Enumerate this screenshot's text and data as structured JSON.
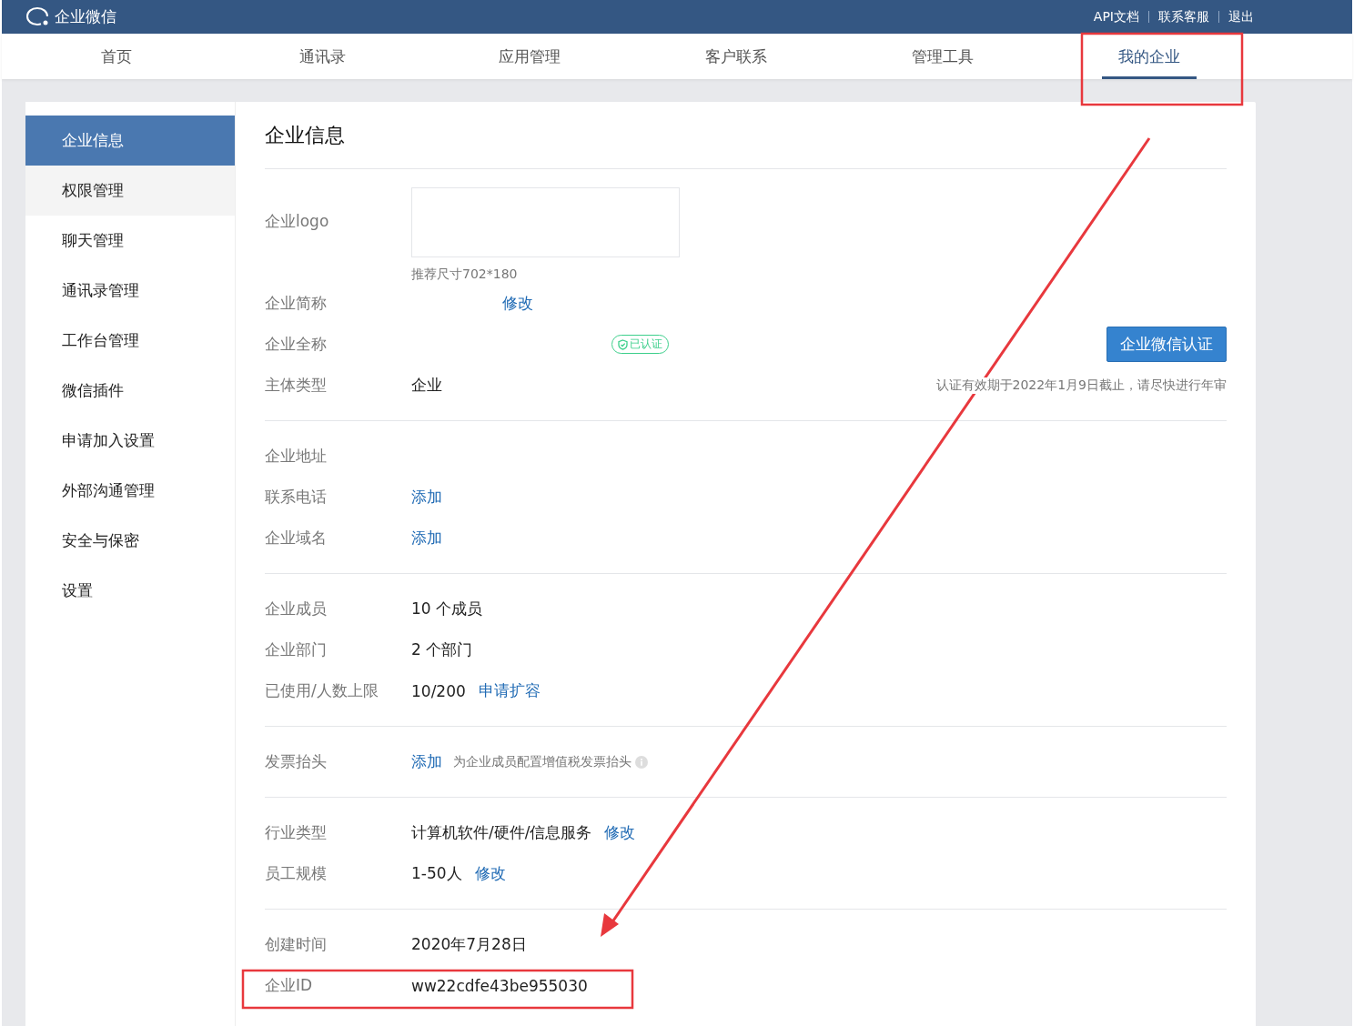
{
  "topbar": {
    "brand": "企业微信",
    "links": [
      "API文档",
      "联系客服",
      "退出"
    ]
  },
  "nav": [
    {
      "label": "首页",
      "selected": false
    },
    {
      "label": "通讯录",
      "selected": false
    },
    {
      "label": "应用管理",
      "selected": false
    },
    {
      "label": "客户联系",
      "selected": false
    },
    {
      "label": "管理工具",
      "selected": false
    },
    {
      "label": "我的企业",
      "selected": true
    }
  ],
  "sidebar": [
    {
      "label": "企业信息",
      "selected": true
    },
    {
      "label": "权限管理",
      "selected": false
    },
    {
      "label": "聊天管理",
      "selected": false
    },
    {
      "label": "通讯录管理",
      "selected": false
    },
    {
      "label": "工作台管理",
      "selected": false
    },
    {
      "label": "微信插件",
      "selected": false
    },
    {
      "label": "申请加入设置",
      "selected": false
    },
    {
      "label": "外部沟通管理",
      "selected": false
    },
    {
      "label": "安全与保密",
      "selected": false
    },
    {
      "label": "设置",
      "selected": false
    }
  ],
  "title": "企业信息",
  "groups": [
    [
      {
        "label": "企业logo",
        "kind": "logo",
        "hint": "推荐尺寸702*180"
      },
      {
        "label": "企业简称",
        "kind": "field",
        "redacted": true,
        "links": [
          "修改"
        ]
      },
      {
        "label": "企业全称",
        "kind": "field",
        "redacted": true,
        "badge": "已认证",
        "action": "企业微信认证"
      },
      {
        "label": "主体类型",
        "kind": "field",
        "value": "企业",
        "note": "认证有效期于2022年1月9日截止，请尽快进行年审"
      }
    ],
    [
      {
        "label": "企业地址",
        "kind": "field"
      },
      {
        "label": "联系电话",
        "kind": "field",
        "links": [
          "添加"
        ]
      },
      {
        "label": "企业域名",
        "kind": "field",
        "links": [
          "添加"
        ]
      }
    ],
    [
      {
        "label": "企业成员",
        "kind": "field",
        "value": "10 个成员"
      },
      {
        "label": "企业部门",
        "kind": "field",
        "value": "2 个部门"
      },
      {
        "label": "已使用/人数上限",
        "kind": "field",
        "value": "10/200",
        "links": [
          "申请扩容"
        ]
      }
    ],
    [
      {
        "label": "发票抬头",
        "kind": "field",
        "links": [
          "添加"
        ],
        "tip": "为企业成员配置增值税发票抬头"
      }
    ],
    [
      {
        "label": "行业类型",
        "kind": "field",
        "value": "计算机软件/硬件/信息服务",
        "links": [
          "修改"
        ]
      },
      {
        "label": "员工规模",
        "kind": "field",
        "value": "1-50人",
        "links": [
          "修改"
        ]
      }
    ],
    [
      {
        "label": "创建时间",
        "kind": "field",
        "value": "2020年7月28日"
      },
      {
        "label": "企业ID",
        "kind": "field",
        "value": "ww22cdfe43be955030"
      }
    ]
  ]
}
